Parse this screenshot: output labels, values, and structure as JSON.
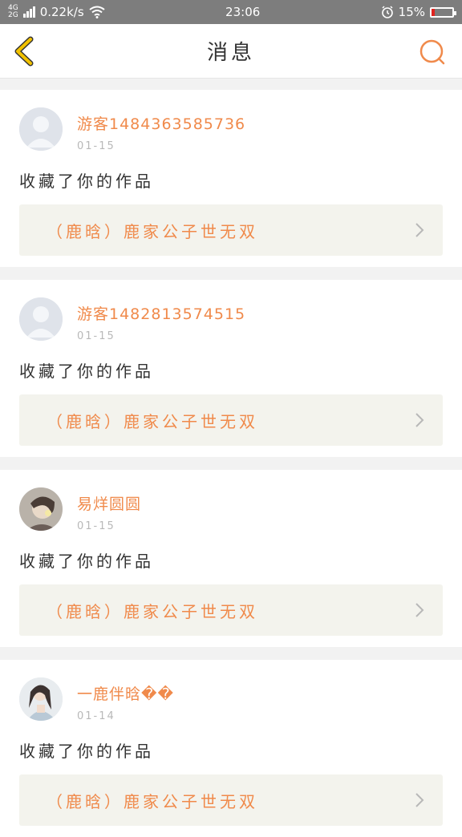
{
  "status_bar": {
    "network_top": "4G",
    "network_bottom": "2G",
    "speed": "0.22k/s",
    "time": "23:06",
    "battery_percent": "15%",
    "battery_level": 0.15
  },
  "header": {
    "title": "消息"
  },
  "messages": [
    {
      "username": "游客1484363585736",
      "date": "01-15",
      "action": "收藏了你的作品",
      "work_title": "（鹿晗）鹿家公子世无双",
      "avatar": "default-avatar"
    },
    {
      "username": "游客1482813574515",
      "date": "01-15",
      "action": "收藏了你的作品",
      "work_title": "（鹿晗）鹿家公子世无双",
      "avatar": "default-avatar"
    },
    {
      "username": "易烊圆圆",
      "date": "01-15",
      "action": "收藏了你的作品",
      "work_title": "（鹿晗）鹿家公子世无双",
      "avatar": "photo-avatar"
    },
    {
      "username": "一鹿伴晗��",
      "date": "01-14",
      "action": "收藏了你的作品",
      "work_title": "（鹿晗）鹿家公子世无双",
      "avatar": "photo-avatar"
    }
  ],
  "colors": {
    "accent": "#f08a4b",
    "back_icon": "#f2c200",
    "status_bar": "#7d7d7d"
  }
}
